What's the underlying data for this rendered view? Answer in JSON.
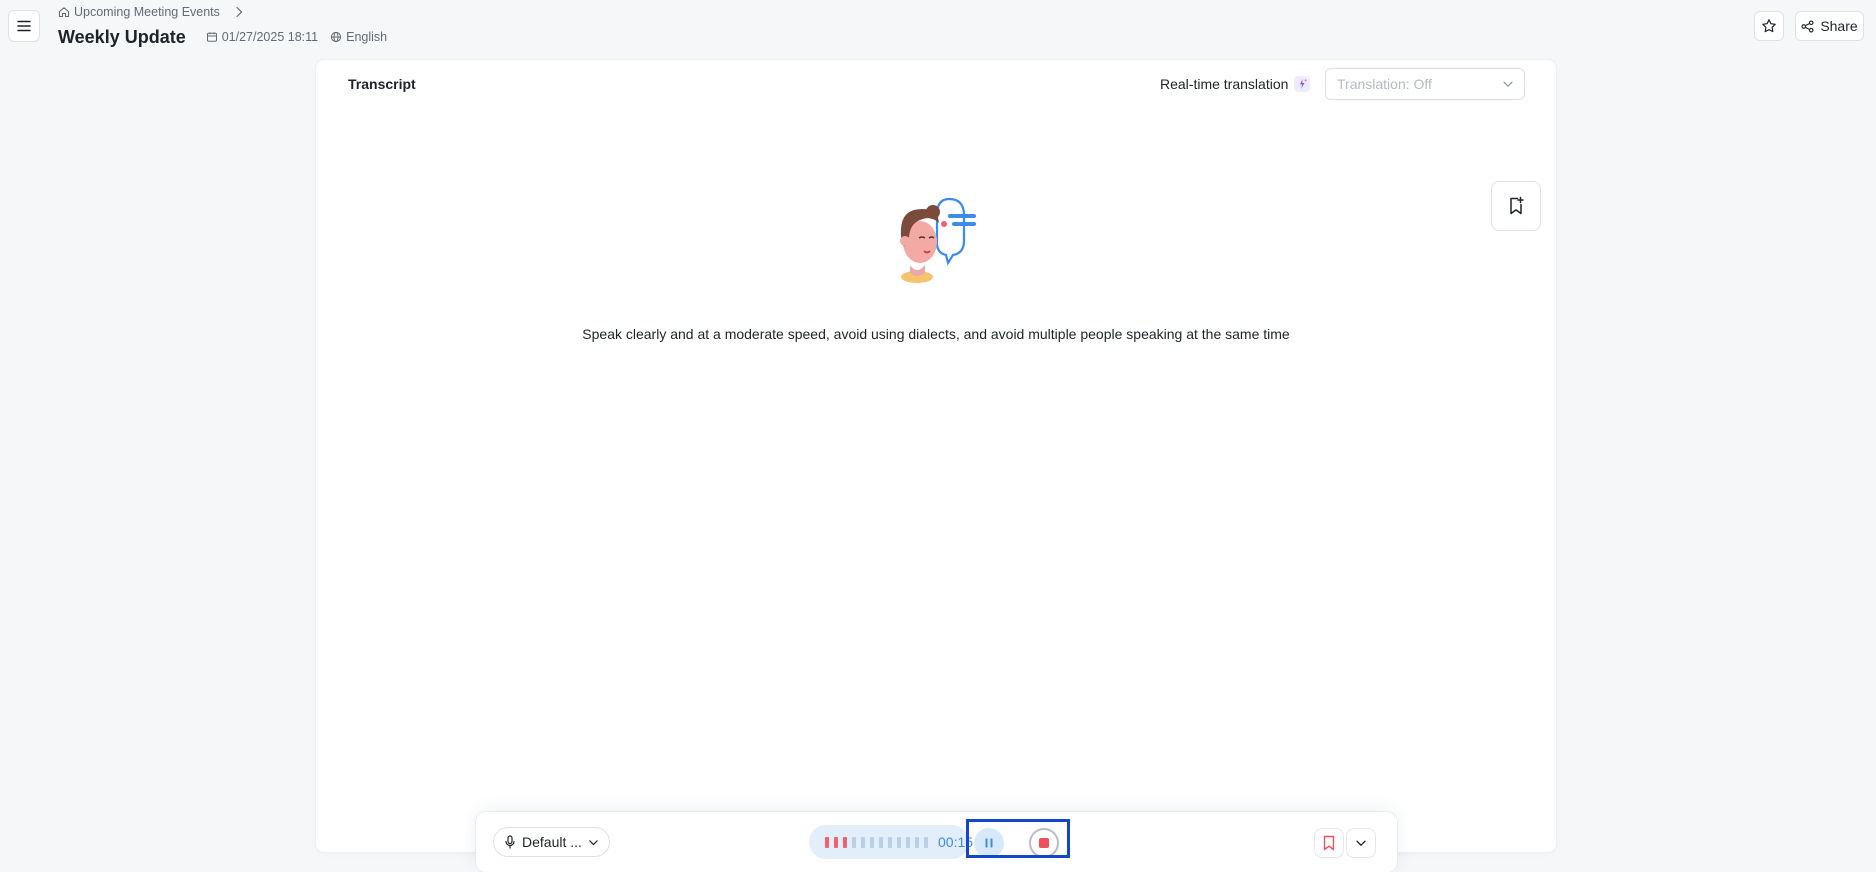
{
  "header": {
    "breadcrumb_parent": "Upcoming Meeting Events",
    "title": "Weekly Update",
    "datetime": "01/27/2025 18:11",
    "language": "English",
    "share_label": "Share"
  },
  "transcript": {
    "title": "Transcript",
    "realtime_translation_label": "Real-time translation",
    "translation_select_value": "Translation: Off",
    "hint": "Speak clearly and at a moderate speed, avoid using dialects, and avoid multiple people speaking at the same time"
  },
  "recorder": {
    "microphone_label": "Default ...",
    "elapsed": "00:15",
    "level_bars_active": 3,
    "level_bars_total": 12
  },
  "colors": {
    "accent": "#3b8bea",
    "record_red": "#f0505e",
    "focus_outline": "#1147cc",
    "page_bg": "#f6f7f9"
  },
  "icons": [
    "menu-icon",
    "home-icon",
    "chevron-right-icon",
    "calendar-icon",
    "globe-icon",
    "star-icon",
    "share-icon",
    "ai-sparkle-icon",
    "chevron-down-icon",
    "bookmark-add-icon",
    "microphone-icon",
    "pause-icon",
    "stop-icon",
    "bookmark-icon"
  ]
}
